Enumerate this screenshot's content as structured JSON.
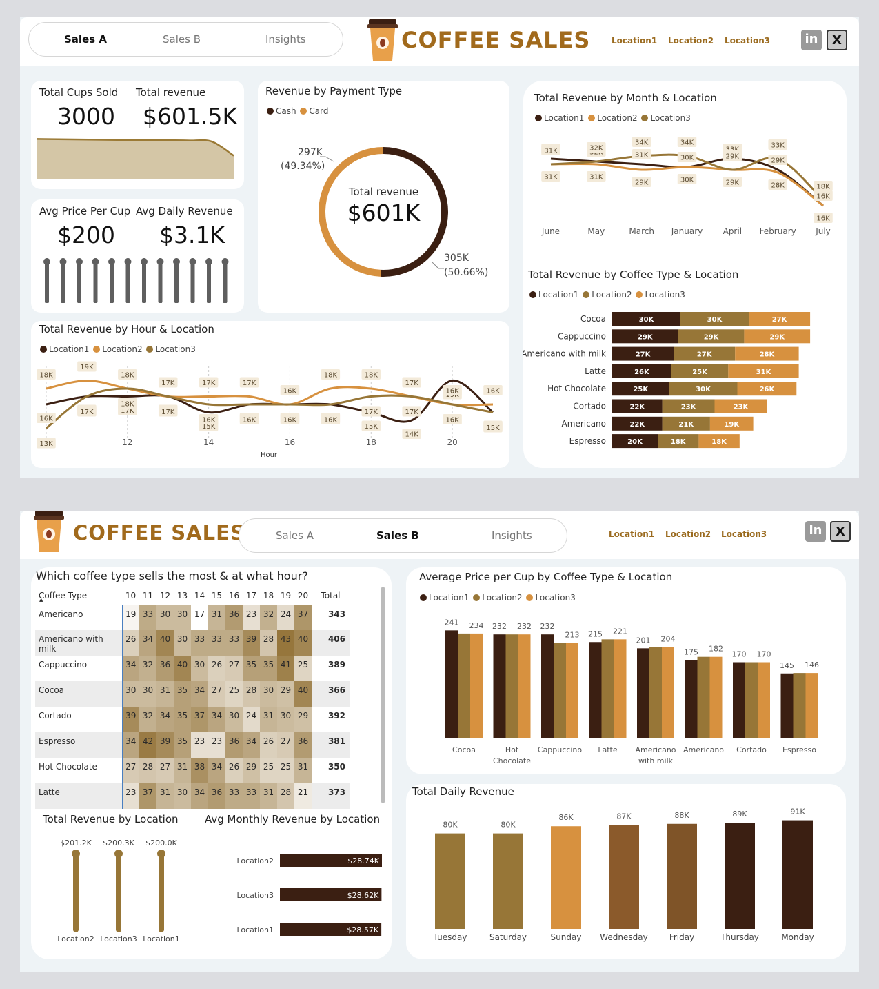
{
  "colors": {
    "location1": "#3b1f12",
    "location2": "#977637",
    "location3": "#d7913f",
    "area": "#d4c6a6",
    "areaLine": "#9b7a35",
    "bulb": "#5f5f5f"
  },
  "nav": {
    "sales_a": "Sales A",
    "sales_b": "Sales B",
    "insights": "Insights"
  },
  "brand": {
    "title": "COFFEE SALES"
  },
  "locations": [
    "Location1",
    "Location2",
    "Location3"
  ],
  "social": {
    "linkedin": "in",
    "x": "X"
  },
  "kpi": {
    "cups_label": "Total Cups Sold",
    "cups_value": "3000",
    "revenue_label": "Total revenue",
    "revenue_value": "$601.5K",
    "avg_price_label": "Avg Price Per Cup",
    "avg_price_value": "$200",
    "avg_daily_label": "Avg Daily Revenue",
    "avg_daily_value": "$3.1K"
  },
  "payment": {
    "title": "Revenue by Payment Type",
    "legend": [
      "Cash",
      "Card"
    ],
    "center_label": "Total revenue",
    "center_value": "$601K",
    "card_label": "297K",
    "card_pct": "(49.34%)",
    "cash_label": "305K",
    "cash_pct": "(50.66%)"
  },
  "hour_title": "Total Revenue by Hour & Location",
  "hour_xlabel": "Hour",
  "month_title": "Total Revenue by Month & Location",
  "type_title": "Total Revenue by Coffee Type & Location",
  "heatmap": {
    "title": "Which coffee type sells the most & at what hour?",
    "col_header": "Coffee Type",
    "hours": [
      "10",
      "11",
      "12",
      "13",
      "14",
      "15",
      "16",
      "17",
      "18",
      "19",
      "20"
    ],
    "total_label": "Total",
    "rows": [
      {
        "name": "Americano",
        "values": [
          19,
          33,
          30,
          30,
          17,
          31,
          36,
          23,
          32,
          24,
          37
        ],
        "total": "343"
      },
      {
        "name": "Americano with milk",
        "values": [
          26,
          34,
          40,
          30,
          33,
          33,
          33,
          39,
          28,
          43,
          40
        ],
        "total": "406"
      },
      {
        "name": "Cappuccino",
        "values": [
          34,
          32,
          36,
          40,
          30,
          26,
          27,
          35,
          35,
          41,
          25
        ],
        "total": "389"
      },
      {
        "name": "Cocoa",
        "values": [
          30,
          30,
          31,
          35,
          34,
          27,
          25,
          28,
          30,
          29,
          40
        ],
        "total": "366"
      },
      {
        "name": "Cortado",
        "values": [
          39,
          32,
          34,
          35,
          37,
          34,
          30,
          24,
          31,
          30,
          29
        ],
        "total": "392"
      },
      {
        "name": "Espresso",
        "values": [
          34,
          42,
          39,
          35,
          23,
          23,
          36,
          34,
          26,
          27,
          36
        ],
        "total": "381"
      },
      {
        "name": "Hot Chocolate",
        "values": [
          27,
          28,
          27,
          31,
          38,
          34,
          26,
          29,
          25,
          25,
          31
        ],
        "total": "350"
      },
      {
        "name": "Latte",
        "values": [
          23,
          37,
          31,
          30,
          34,
          36,
          33,
          33,
          31,
          28,
          21
        ],
        "total": "373"
      }
    ]
  },
  "loc_rev_title": "Total Revenue by Location",
  "avg_month_title": "Avg Monthly Revenue by Location",
  "avg_price_title": "Average Price per Cup by Coffee Type & Location",
  "daily_title": "Total Daily Revenue",
  "chart_data": [
    {
      "id": "cups_area",
      "type": "area",
      "title": "",
      "x": [
        1,
        2,
        3,
        4,
        5,
        6,
        7,
        8,
        9,
        10
      ],
      "values": [
        310,
        308,
        306,
        304,
        302,
        300,
        300,
        298,
        290,
        180
      ]
    },
    {
      "id": "price_lollipop",
      "type": "scatter",
      "title": "",
      "values": [
        200,
        200,
        200,
        200,
        200,
        200,
        200,
        200,
        200,
        200,
        200,
        200
      ]
    },
    {
      "id": "payment_donut",
      "type": "pie",
      "title": "Revenue by Payment Type",
      "categories": [
        "Cash",
        "Card"
      ],
      "values": [
        305,
        297
      ],
      "labels": [
        "305K",
        "297K"
      ]
    },
    {
      "id": "hour_line",
      "type": "line",
      "title": "Total Revenue by Hour & Location",
      "xlabel": "Hour",
      "x": [
        10,
        11,
        12,
        13,
        14,
        15,
        16,
        17,
        18,
        19,
        20,
        21
      ],
      "xticks": [
        10,
        12,
        14,
        16,
        18,
        20
      ],
      "series": [
        {
          "name": "Location1",
          "values": [
            16,
            17,
            17,
            17,
            15,
            16,
            16,
            16,
            15,
            14,
            19,
            15
          ],
          "labels": [
            "16K",
            "17K",
            "17K",
            "17K",
            "15K",
            "16K",
            "16K",
            "16K",
            "15K",
            "14K",
            "19K",
            "15K"
          ]
        },
        {
          "name": "Location2",
          "values": [
            18,
            19,
            18,
            17,
            17,
            17,
            16,
            18,
            18,
            17,
            16,
            16
          ],
          "labels": [
            "18K",
            "19K",
            "18K",
            "17K",
            "17K",
            "17K",
            "16K",
            "18K",
            "18K",
            "17K",
            "16K",
            "16K"
          ]
        },
        {
          "name": "Location3",
          "values": [
            13,
            17,
            18,
            17,
            16,
            16,
            16,
            16,
            17,
            17,
            16,
            15
          ],
          "labels": [
            "13K",
            "17K",
            "18K",
            "17K",
            "16K",
            "16K",
            "16K",
            "16K",
            "17K",
            "17K",
            "16K",
            "15K"
          ]
        }
      ]
    },
    {
      "id": "month_line",
      "type": "line",
      "title": "Total Revenue by Month & Location",
      "categories": [
        "June",
        "May",
        "March",
        "January",
        "April",
        "February",
        "July"
      ],
      "series": [
        {
          "name": "Location1",
          "values": [
            33,
            32,
            31,
            30,
            33,
            29,
            16
          ],
          "labels": [
            "33K",
            "32K",
            "31K",
            "30K",
            "33K",
            "29K",
            "16K"
          ]
        },
        {
          "name": "Location2",
          "values": [
            31,
            31,
            29,
            30,
            29,
            28,
            16
          ],
          "labels": [
            "31K",
            "31K",
            "29K",
            "30K",
            "29K",
            "28K",
            "16K"
          ]
        },
        {
          "name": "Location3",
          "values": [
            31,
            32,
            34,
            34,
            29,
            33,
            18
          ],
          "labels": [
            "31K",
            "32K",
            "34K",
            "34K",
            "29K",
            "33K",
            "18K"
          ]
        }
      ]
    },
    {
      "id": "type_stacked",
      "type": "bar",
      "title": "Total Revenue by Coffee Type & Location",
      "categories": [
        "Cocoa",
        "Cappuccino",
        "Americano with milk",
        "Latte",
        "Hot Chocolate",
        "Cortado",
        "Americano",
        "Espresso"
      ],
      "series": [
        {
          "name": "Location1",
          "values": [
            30,
            29,
            27,
            26,
            25,
            22,
            22,
            20
          ]
        },
        {
          "name": "Location2",
          "values": [
            30,
            29,
            27,
            25,
            30,
            23,
            21,
            18
          ]
        },
        {
          "name": "Location3",
          "values": [
            27,
            29,
            28,
            31,
            26,
            23,
            19,
            18
          ]
        }
      ]
    },
    {
      "id": "location_lollipop",
      "type": "bar",
      "title": "Total Revenue by Location",
      "categories": [
        "Location2",
        "Location3",
        "Location1"
      ],
      "values": [
        201.2,
        200.3,
        200.0
      ],
      "labels": [
        "$201.2K",
        "$200.3K",
        "$200.0K"
      ]
    },
    {
      "id": "avg_monthly",
      "type": "bar",
      "title": "Avg Monthly Revenue by Location",
      "categories": [
        "Location2",
        "Location3",
        "Location1"
      ],
      "values": [
        28.74,
        28.62,
        28.57
      ],
      "labels": [
        "$28.74K",
        "$28.62K",
        "$28.57K"
      ]
    },
    {
      "id": "avg_price",
      "type": "bar",
      "title": "Average Price per Cup by Coffee Type & Location",
      "categories": [
        "Cocoa",
        "Hot Chocolate",
        "Cappuccino",
        "Latte",
        "Americano with milk",
        "Americano",
        "Cortado",
        "Espresso"
      ],
      "series": [
        {
          "name": "Location1",
          "values": [
            241,
            232,
            232,
            215,
            201,
            175,
            170,
            145
          ]
        },
        {
          "name": "Location2",
          "values": [
            234,
            232,
            213,
            221,
            204,
            182,
            170,
            146
          ]
        },
        {
          "name": "Location3",
          "values": [
            234,
            232,
            213,
            221,
            204,
            182,
            170,
            146
          ]
        }
      ],
      "labels": [
        "241",
        "234",
        "232",
        "232",
        "232",
        "213",
        "215",
        "221",
        "201",
        "204",
        "175",
        "182",
        "170",
        "170",
        "145",
        "146"
      ]
    },
    {
      "id": "daily_revenue",
      "type": "bar",
      "title": "Total Daily Revenue",
      "categories": [
        "Tuesday",
        "Saturday",
        "Sunday",
        "Wednesday",
        "Friday",
        "Thursday",
        "Monday"
      ],
      "values": [
        80,
        80,
        86,
        87,
        88,
        89,
        91
      ],
      "labels": [
        "80K",
        "80K",
        "86K",
        "87K",
        "88K",
        "89K",
        "91K"
      ],
      "colors": [
        "#977637",
        "#977637",
        "#d7913f",
        "#8b5a2b",
        "#7f5428",
        "#3b1f12",
        "#3b1f12"
      ]
    }
  ]
}
